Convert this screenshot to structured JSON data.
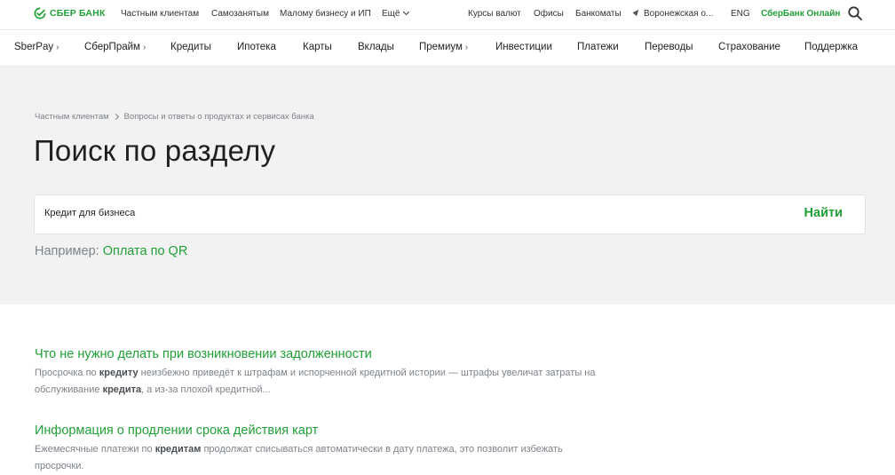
{
  "brand": {
    "name": "СБЕР БАНК",
    "color": "#21a038"
  },
  "topbar": {
    "left_links": [
      "Частным клиентам",
      "Самозанятым",
      "Малому бизнесу и ИП",
      "Ещё"
    ],
    "right_links": [
      "Курсы валют",
      "Офисы",
      "Банкоматы"
    ],
    "location": "Воронежская о...",
    "language": "ENG",
    "online": "СберБанк Онлайн",
    "search_icon": "search-icon"
  },
  "nav": {
    "items": [
      {
        "label": "SberPay",
        "arrow": "›"
      },
      {
        "label": "СберПрайм",
        "arrow": "›"
      },
      {
        "label": "Кредиты",
        "arrow": ""
      },
      {
        "label": "Ипотека",
        "arrow": ""
      },
      {
        "label": "Карты",
        "arrow": ""
      },
      {
        "label": "Вклады",
        "arrow": ""
      },
      {
        "label": "Премиум",
        "arrow": "›"
      },
      {
        "label": "Инвестиции",
        "arrow": ""
      },
      {
        "label": "Платежи",
        "arrow": ""
      },
      {
        "label": "Переводы",
        "arrow": ""
      },
      {
        "label": "Страхование",
        "arrow": ""
      },
      {
        "label": "Поддержка",
        "arrow": ""
      }
    ]
  },
  "breadcrumb": [
    "Частным клиентам",
    "Вопросы и ответы о продуктах и сервисах банка"
  ],
  "page_title": "Поиск по разделу",
  "search": {
    "value": "Кредит для бизнеса",
    "button": "Найти"
  },
  "example": {
    "label": "Например:",
    "link": "Оплата по QR"
  },
  "results": [
    {
      "title": "Что не нужно делать при возникновении задолженности",
      "snippet": [
        {
          "t": "Просрочка по ",
          "b": false
        },
        {
          "t": "кредиту",
          "b": true
        },
        {
          "t": " неизбежно приведёт к штрафам и испорченной кредитной истории — штрафы увеличат затраты на обслуживание ",
          "b": false
        },
        {
          "t": "кредита",
          "b": true
        },
        {
          "t": ", а из-за плохой кредитной...",
          "b": false
        }
      ]
    },
    {
      "title": "Информация о продлении срока действия карт",
      "snippet": [
        {
          "t": "Ежемесячные платежи по ",
          "b": false
        },
        {
          "t": "кредитам",
          "b": true
        },
        {
          "t": " продолжат списываться автоматически в дату платежа, это позволит избежать просрочки.",
          "b": false
        }
      ]
    }
  ]
}
